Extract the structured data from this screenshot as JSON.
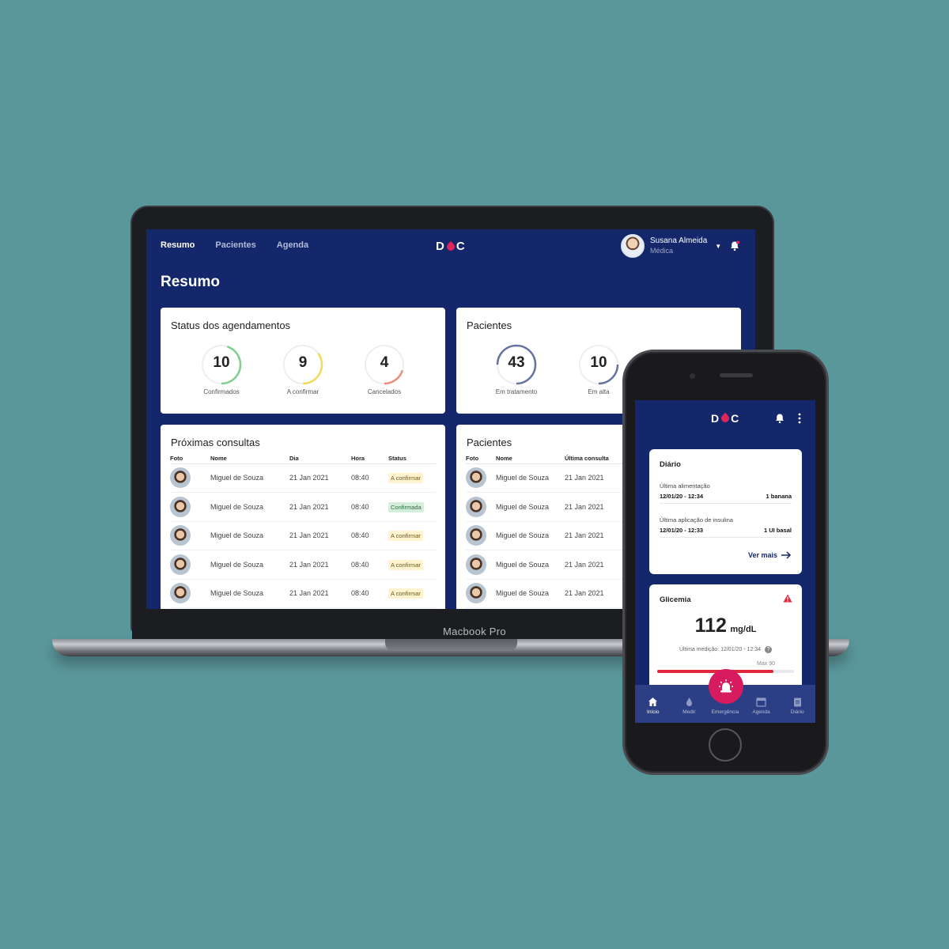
{
  "laptop": {
    "brand": "Macbook Pro",
    "nav": [
      {
        "label": "Resumo",
        "active": true
      },
      {
        "label": "Pacientes",
        "active": false
      },
      {
        "label": "Agenda",
        "active": false
      }
    ],
    "logo": {
      "left": "D",
      "right": "C"
    },
    "user": {
      "name": "Susana Almeida",
      "role": "Médica"
    },
    "page_title": "Resumo",
    "status_card": {
      "title": "Status dos agendamentos",
      "rings": [
        {
          "value": "10",
          "label": "Confirmados",
          "color": "#7fcf8f",
          "fraction": 0.45
        },
        {
          "value": "9",
          "label": "A confirmar",
          "color": "#f2d95a",
          "fraction": 0.35
        },
        {
          "value": "4",
          "label": "Cancelados",
          "color": "#f08a7c",
          "fraction": 0.2
        }
      ]
    },
    "patients_card": {
      "title": "Pacientes",
      "rings": [
        {
          "value": "43",
          "label": "Em tratamento",
          "color": "#6672a0",
          "fraction": 0.75
        },
        {
          "value": "10",
          "label": "Em alta",
          "color": "#6672a0",
          "fraction": 0.25
        }
      ]
    },
    "appointments": {
      "title": "Próximas consultas",
      "columns": [
        "Foto",
        "Nome",
        "Dia",
        "Hora",
        "Status"
      ],
      "rows": [
        {
          "name": "Miguel de Souza",
          "day": "21 Jan 2021",
          "time": "08:40",
          "status": "A confirmar",
          "type": "pending"
        },
        {
          "name": "Miguel de Souza",
          "day": "21 Jan 2021",
          "time": "08:40",
          "status": "Confirmada",
          "type": "ok"
        },
        {
          "name": "Miguel de Souza",
          "day": "21 Jan 2021",
          "time": "08:40",
          "status": "A confirmar",
          "type": "pending"
        },
        {
          "name": "Miguel de Souza",
          "day": "21 Jan 2021",
          "time": "08:40",
          "status": "A confirmar",
          "type": "pending"
        },
        {
          "name": "Miguel de Souza",
          "day": "21 Jan 2021",
          "time": "08:40",
          "status": "A confirmar",
          "type": "pending"
        }
      ]
    },
    "patients_list": {
      "title": "Pacientes",
      "columns": [
        "Foto",
        "Nome",
        "Última consulta"
      ],
      "rows": [
        {
          "name": "Miguel de Souza",
          "last": "21 Jan 2021"
        },
        {
          "name": "Miguel de Souza",
          "last": "21 Jan 2021"
        },
        {
          "name": "Miguel de Souza",
          "last": "21 Jan 2021"
        },
        {
          "name": "Miguel de Souza",
          "last": "21 Jan 2021"
        },
        {
          "name": "Miguel de Souza",
          "last": "21 Jan 2021"
        }
      ]
    }
  },
  "phone": {
    "logo": {
      "left": "D",
      "right": "C"
    },
    "diary": {
      "title": "Diário",
      "meal_label": "Última alimentação",
      "meal_time": "12/01/20 - 12:34",
      "meal_value": "1 banana",
      "insulin_label": "Última aplicação de insulina",
      "insulin_time": "12/01/20 - 12:33",
      "insulin_value": "1 UI basal",
      "more": "Ver mais"
    },
    "glucose": {
      "title": "Glicemia",
      "value": "112",
      "unit": "mg/dL",
      "last": "Última medição: 12/01/20 - 12:34",
      "max": "Max 90",
      "level": 0.85
    },
    "tabs": [
      {
        "label": "Início",
        "active": true
      },
      {
        "label": "Medir",
        "active": false
      },
      {
        "label": "Emergência",
        "active": false
      },
      {
        "label": "Agenda",
        "active": false
      },
      {
        "label": "Diário",
        "active": false
      }
    ]
  },
  "colors": {
    "primary": "#13276a",
    "accent": "#e0245e",
    "background": "#5a979b"
  }
}
